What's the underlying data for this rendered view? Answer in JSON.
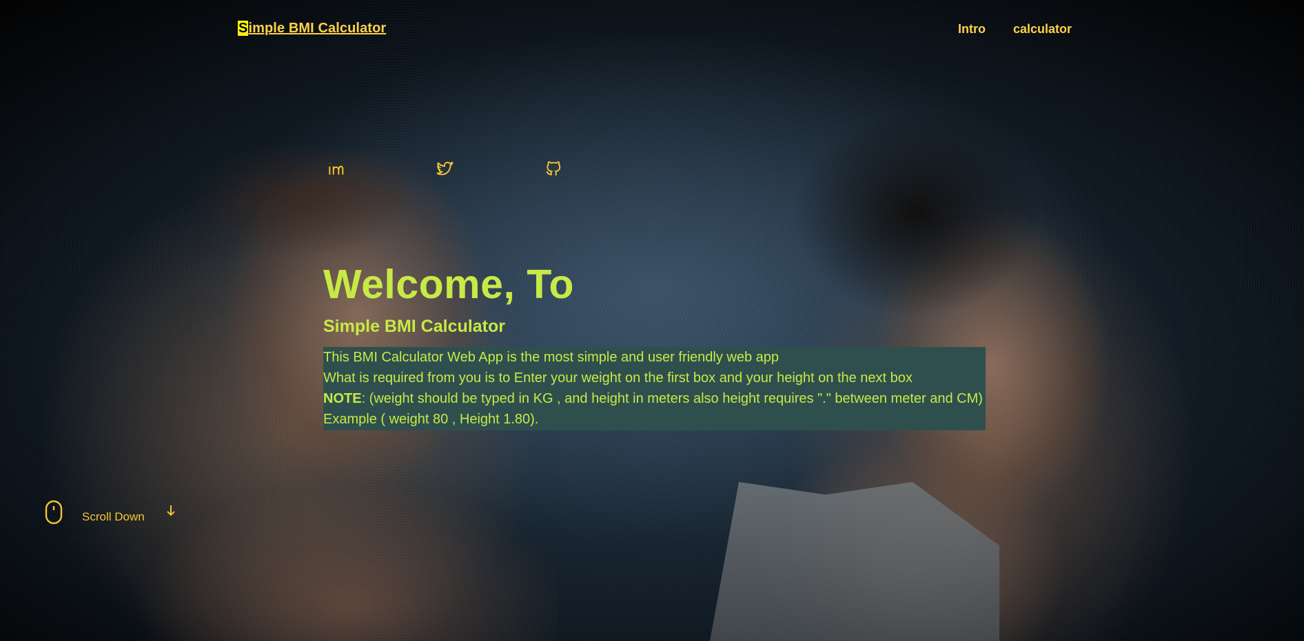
{
  "header": {
    "brand_first_letter": "S",
    "brand_rest": "imple BMI Calculator",
    "nav": [
      {
        "label": "Intro"
      },
      {
        "label": "calculator"
      }
    ]
  },
  "social": [
    {
      "icon": "linkedin-icon"
    },
    {
      "icon": "twitter-icon"
    },
    {
      "icon": "github-icon"
    }
  ],
  "hero": {
    "title": "Welcome, To",
    "subtitle": "Simple BMI Calculator",
    "line1": "This BMI Calculator Web App is the most simple and user friendly web app",
    "line2": "What is required from you is to Enter your weight on the first box and your height on the next box",
    "note_label": "NOTE",
    "note_text": ": (weight should be typed in KG , and height in meters also height requires \".\" between meter and CM)",
    "example": "Example ( weight 80 , Height 1.80)."
  },
  "scroll": {
    "label": "Scroll Down",
    "mouse_icon": "mouse-icon",
    "arrow_icon": "arrow-down-icon"
  },
  "colors": {
    "accent": "#ffd24a",
    "hero_text": "#c7ea46",
    "info_bg": "#2f4f4f"
  }
}
